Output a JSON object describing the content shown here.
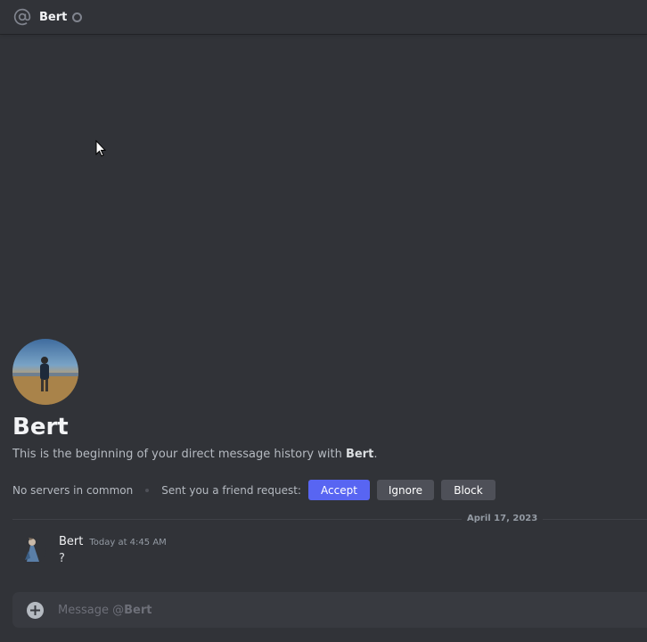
{
  "header": {
    "icon": "at-sign-icon",
    "name": "Bert",
    "status_icon": "offline-status-icon"
  },
  "intro": {
    "name": "Bert",
    "description_prefix": "This is the beginning of your direct message history with ",
    "description_name": "Bert",
    "description_suffix": "."
  },
  "actions": {
    "servers_label": "No servers in common",
    "friend_request_label": "Sent you a friend request:",
    "accept_label": "Accept",
    "ignore_label": "Ignore",
    "block_label": "Block"
  },
  "divider": {
    "date": "April 17, 2023"
  },
  "messages": [
    {
      "author": "Bert",
      "timestamp": "Today at 4:45 AM",
      "text": "?"
    }
  ],
  "composer": {
    "placeholder_prefix": "Message @",
    "placeholder_name": "Bert",
    "plus_icon": "plus-circle-icon"
  },
  "colors": {
    "background": "#313338",
    "accent": "#5865f2",
    "secondary_button": "#4e5058",
    "composer": "#383a40"
  }
}
